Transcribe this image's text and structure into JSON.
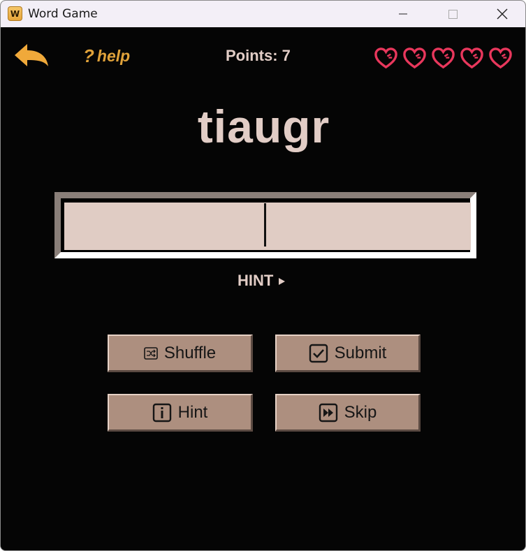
{
  "window": {
    "title": "Word Game",
    "icon_letter": "W"
  },
  "header": {
    "back_icon": "back-arrow-icon",
    "help_label": "help",
    "help_mark": "?",
    "points_label": "Points: ",
    "points_value": "7",
    "lives": 5,
    "heart_icon": "heart-icon",
    "heart_color": "#e8375c"
  },
  "game": {
    "scrambled_word": "tiaugr",
    "answer_value": "",
    "hint_toggle_label": "HINT"
  },
  "buttons": {
    "shuffle": "Shuffle",
    "submit": "Submit",
    "hint": "Hint",
    "skip": "Skip"
  },
  "colors": {
    "background": "#050505",
    "accent": "#e0a23a",
    "text": "#e2cdc6",
    "button": "#ad8f7f",
    "input": "#e0ccc4"
  }
}
